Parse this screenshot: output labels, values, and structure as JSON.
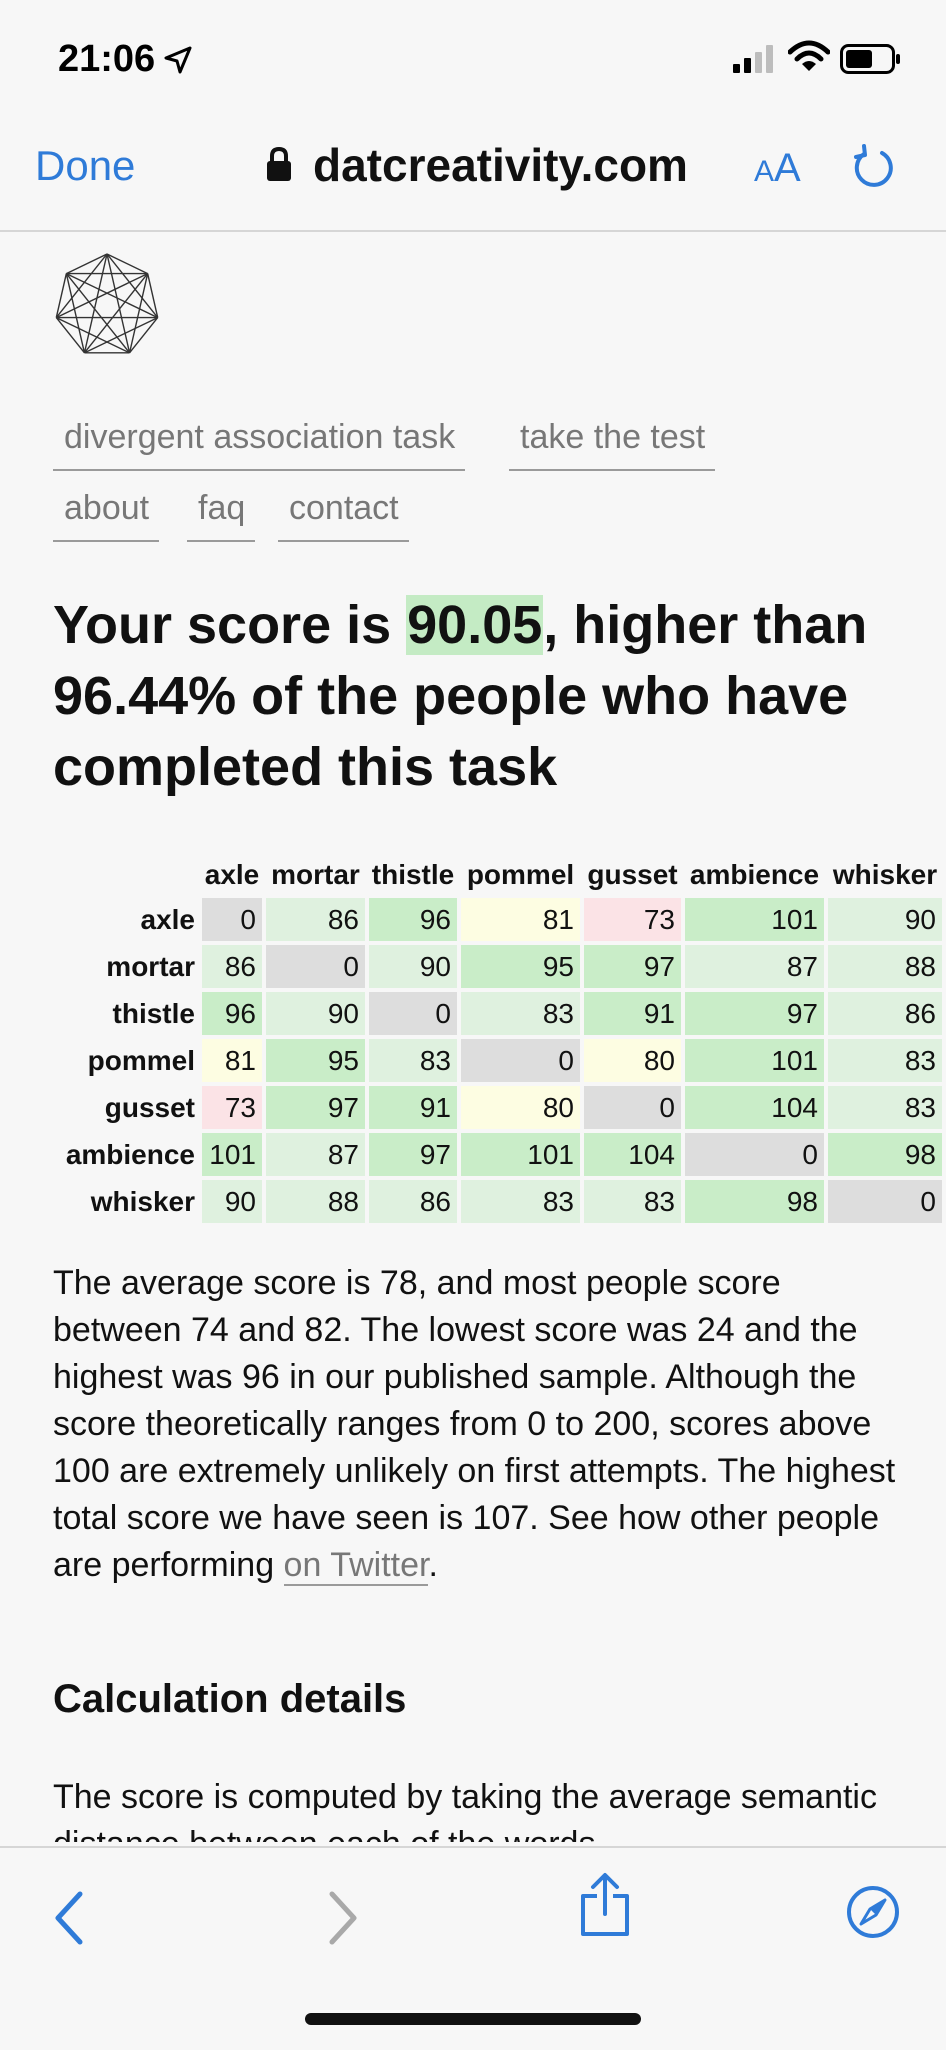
{
  "status_bar": {
    "time": "21:06",
    "icons": [
      "location-arrow-icon",
      "signal-icon",
      "wifi-icon",
      "battery-icon"
    ]
  },
  "browser": {
    "done_label": "Done",
    "domain": "datcreativity.com",
    "text_size_label_small": "A",
    "text_size_label_large": "A"
  },
  "nav": {
    "items": [
      "divergent association task",
      "take the test",
      "about",
      "faq",
      "contact"
    ]
  },
  "headline": {
    "prefix": "Your score is ",
    "score": "90.05",
    "suffix": ", higher than 96.44% of the people who have completed this task"
  },
  "matrix": {
    "words": [
      "axle",
      "mortar",
      "thistle",
      "pommel",
      "gusset",
      "ambience",
      "whisker"
    ],
    "values": [
      [
        0,
        86,
        96,
        81,
        73,
        101,
        90
      ],
      [
        86,
        0,
        90,
        95,
        97,
        87,
        88
      ],
      [
        96,
        90,
        0,
        83,
        91,
        97,
        86
      ],
      [
        81,
        95,
        83,
        0,
        80,
        101,
        83
      ],
      [
        73,
        97,
        91,
        80,
        0,
        104,
        83
      ],
      [
        101,
        87,
        97,
        101,
        104,
        0,
        98
      ],
      [
        90,
        88,
        86,
        83,
        83,
        98,
        0
      ]
    ],
    "colors": {
      "diagonal": "#dddddd",
      "low": "#fbe3e6",
      "mid_low": "#fdfde2",
      "mid": "#dff1df",
      "high": "#c9edc8"
    }
  },
  "paragraph": {
    "text": "The average score is 78, and most people score between 74 and 82. The lowest score was 24 and the highest was 96 in our published sample. Although the score theoretically ranges from 0 to 200, scores above 100 are extremely unlikely on first attempts. The highest total score we have seen is 107. See how other people are performing ",
    "link_label": "on Twitter",
    "end": "."
  },
  "calc": {
    "title": "Calculation details",
    "text": "The score is computed by taking the average semantic distance between each of the words"
  },
  "toolbar": {
    "icons": [
      "back-icon",
      "forward-icon",
      "share-icon",
      "compass-icon"
    ]
  }
}
